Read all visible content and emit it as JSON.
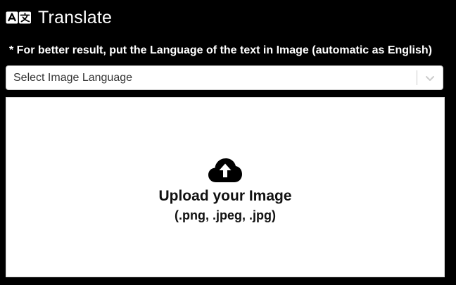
{
  "header": {
    "icon": "translate-icon",
    "title": "Translate"
  },
  "hint": "* For better result, put the Language of the text in Image (automatic as English)",
  "language_select": {
    "placeholder": "Select Image Language",
    "icon": "chevron-down-icon"
  },
  "upload": {
    "icon": "cloud-upload-icon",
    "title": "Upload your Image",
    "formats": "(.png, .jpeg, .jpg)"
  },
  "colors": {
    "background": "#000000",
    "text_on_dark": "#ffffff",
    "panel": "#ffffff",
    "border": "#cccccc"
  }
}
